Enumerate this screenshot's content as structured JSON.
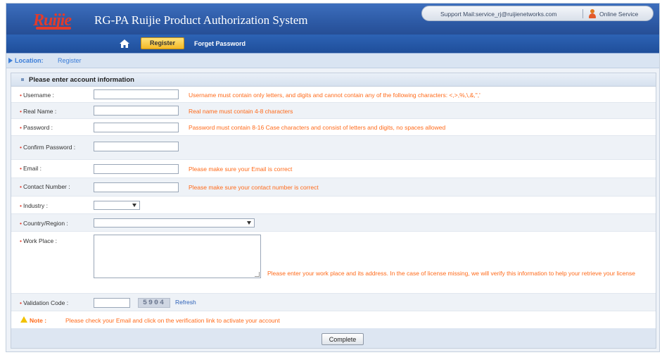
{
  "header": {
    "logo_text": "Ruijie",
    "system_title": "RG-PA Ruijie Product Authorization System",
    "support_mail": "Support Mail:service_rj@ruijienetworks.com",
    "online_service": "Online Service"
  },
  "nav": {
    "register": "Register",
    "forget_password": "Forget Password"
  },
  "location": {
    "label": "Location:",
    "value": "Register"
  },
  "form": {
    "title": "Please enter account information",
    "fields": {
      "username": {
        "label": "Username :",
        "hint": "Username must contain only letters, and digits and cannot contain any of the following characters: <,>,%,\\,&,\",'"
      },
      "real_name": {
        "label": "Real Name :",
        "hint": "Real name must contain 4-8 characters"
      },
      "password": {
        "label": "Password :",
        "hint": "Password must contain 8-16 Case characters and consist of letters and digits, no spaces allowed"
      },
      "confirm_password": {
        "label": "Confirm Password :"
      },
      "email": {
        "label": "Email :",
        "hint": "Please make sure your Email is correct"
      },
      "contact_number": {
        "label": "Contact Number :",
        "hint": "Please make sure your contact number is correct"
      },
      "industry": {
        "label": "Industry :"
      },
      "country_region": {
        "label": "Country/Region :"
      },
      "work_place": {
        "label": "Work Place :",
        "hint": "Please enter your work place and its address. In the case of license missing, we will verify this information to help your retrieve your license"
      },
      "validation_code": {
        "label": "Validation Code :",
        "captcha": "5904",
        "refresh": "Refresh"
      }
    },
    "note_label": "Note :",
    "note_text": "Please check your Email and click on the verification link to activate your account",
    "complete_button": "Complete"
  },
  "colors": {
    "header_blue": "#2d5aa5",
    "hint_orange": "#ff6a1a",
    "required_red": "#e33b2a",
    "register_yellow": "#f4b927"
  }
}
